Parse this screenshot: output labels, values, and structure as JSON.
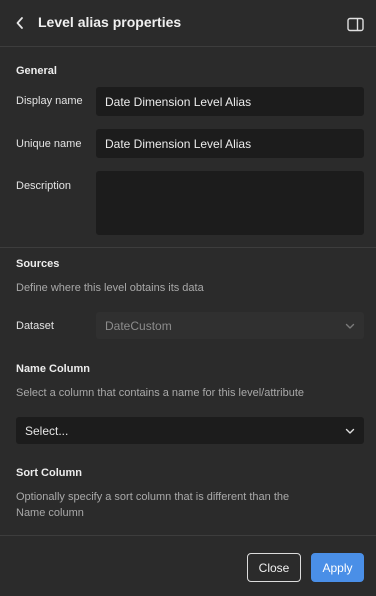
{
  "header": {
    "title": "Level alias properties",
    "back_icon": "chevron-left-icon",
    "toggle_icon": "side-panel-icon"
  },
  "general": {
    "section_title": "General",
    "display_name_label": "Display name",
    "display_name_value": "Date Dimension Level Alias",
    "unique_name_label": "Unique name",
    "unique_name_value": "Date Dimension Level Alias",
    "description_label": "Description",
    "description_value": ""
  },
  "sources": {
    "section_title": "Sources",
    "help": "Define where this level obtains its data",
    "dataset_label": "Dataset",
    "dataset_value": "DateCustom"
  },
  "name_column": {
    "section_title": "Name Column",
    "help": "Select a column that contains a name for this level/attribute",
    "selected": "Select..."
  },
  "sort_column": {
    "section_title": "Sort Column",
    "help_line1": "Optionally specify a sort column that is different than the",
    "help_line2": "Name column"
  },
  "footer": {
    "close_label": "Close",
    "apply_label": "Apply"
  },
  "colors": {
    "background": "#2b2b2b",
    "input_background": "#1c1c1c",
    "primary": "#4a8fe7"
  }
}
